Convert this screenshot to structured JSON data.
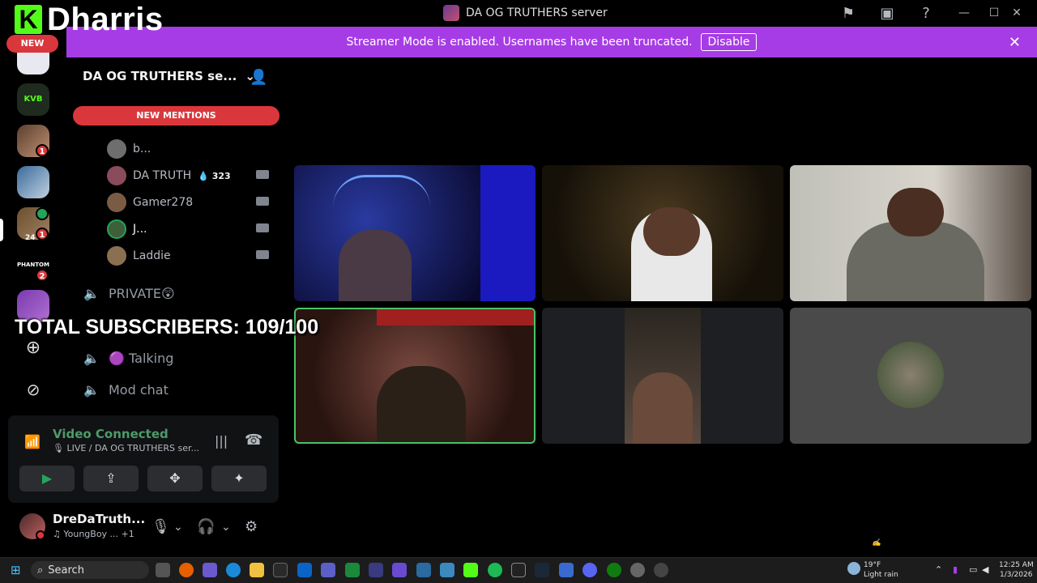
{
  "brand": {
    "logo": "K",
    "name": "Dharris"
  },
  "window": {
    "title": "DA OG TRUTHERS server"
  },
  "banner": {
    "text": "Streamer Mode is enabled. Usernames have been truncated.",
    "button": "Disable"
  },
  "rail": {
    "new_label": "NEW",
    "badges": [
      "1",
      "1",
      "2"
    ],
    "badge_24": "24",
    "server_labels": [
      "KVB",
      "PHANTOMS"
    ]
  },
  "server": {
    "name": "DA OG TRUTHERS se...",
    "new_mentions": "NEW MENTIONS"
  },
  "voice_users": [
    {
      "name": "b...",
      "color": "#6e6e6e"
    },
    {
      "name": "DA TRUTH",
      "badge": "323",
      "color": "#8a4b5a"
    },
    {
      "name": "Gamer278",
      "color": "#7a5c44"
    },
    {
      "name": "J...",
      "color": "#3f5e3a"
    },
    {
      "name": "Laddie",
      "color": "#8a7050"
    }
  ],
  "channels": [
    {
      "name": "PRIVATE😲",
      "icon": "speaker-lock-icon"
    },
    {
      "name": "🟣 Talking",
      "icon": "speaker-icon"
    },
    {
      "name": "Mod chat",
      "icon": "speaker-lock-icon"
    }
  ],
  "overlay": {
    "text": "TOTAL SUBSCRIBERS: 109/100"
  },
  "voice_panel": {
    "status": "Video Connected",
    "sub": "🎙 LIVE / DA OG TRUTHERS ser..."
  },
  "user": {
    "name": "DreDaTruth...",
    "activity": "♫ YoungBoy ... +1"
  },
  "tiles": [
    {
      "label": "streamer-blue-room"
    },
    {
      "label": "dark-bedroom"
    },
    {
      "label": "bright-bedroom"
    },
    {
      "label": "red-room-speaking"
    },
    {
      "label": "dark-face"
    },
    {
      "label": "avatar-only"
    }
  ],
  "taskbar": {
    "search": "Search",
    "weather_temp": "19°F",
    "weather_desc": "Light rain",
    "time": "12:25 AM",
    "date": "1/3/2026"
  },
  "colors": {
    "banner": "#a63ce6",
    "kick_green": "#53fc18",
    "mention_red": "#da373c",
    "connected_green": "#4e9a6a",
    "speaking_border": "#4ac26a"
  }
}
